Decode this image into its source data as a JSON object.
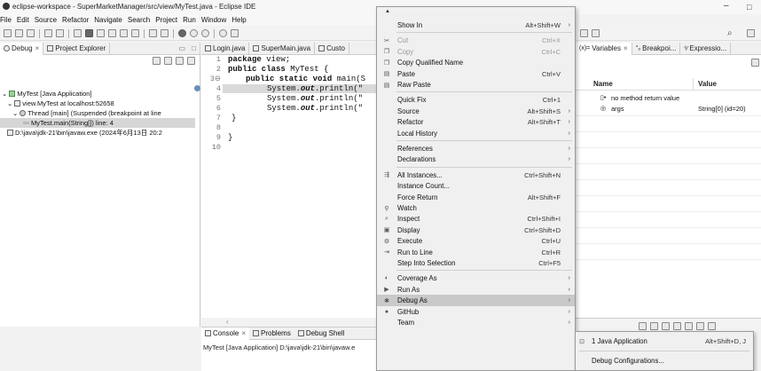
{
  "window": {
    "title": "eclipse-workspace - SuperMarketManager/src/view/MyTest.java - Eclipse IDE",
    "minimize": "–",
    "restore": "□"
  },
  "menubar": [
    "File",
    "Edit",
    "Source",
    "Refactor",
    "Navigate",
    "Search",
    "Project",
    "Run",
    "Window",
    "Help"
  ],
  "left_panel": {
    "tabs": [
      "Debug",
      "Project Explorer"
    ],
    "tab_icons": [
      "bug-icon",
      "folder-icon"
    ],
    "tree": [
      "MyTest [Java Application]",
      "view.MyTest at localhost:52658",
      "Thread [main] (Suspended (breakpoint at line",
      "MyTest.main(String[]) line: 4",
      "D:\\java\\jdk-21\\bin\\javaw.exe (2024年6月13日 20:2"
    ]
  },
  "editor": {
    "tabs": [
      "Login.java",
      "SuperMain.java",
      "Custo"
    ],
    "line_numbers": [
      "1",
      "2",
      "3⊖",
      "4",
      "5",
      "6",
      "7",
      "8",
      "9",
      "10"
    ],
    "lines": {
      "l1_kw": "package",
      "l1_rest": " view;",
      "l2_kw": "public class",
      "l2_rest": " MyTest {",
      "l3_kw": "public static void",
      "l3_rest": " main(S",
      "l4_pre": "System.",
      "l4_it": "out",
      "l4_post": ".println(\"",
      "l5_pre": "System.",
      "l5_it": "out",
      "l5_post": ".println(\"",
      "l6_pre": "System.",
      "l6_it": "out",
      "l6_post": ".println(\"",
      "l7": "}",
      "l9": "}"
    }
  },
  "bottom_panel": {
    "tabs": [
      "Console",
      "Problems",
      "Debug Shell"
    ],
    "console_text": "MyTest [Java Application] D:\\java\\jdk-21\\bin\\javaw.e"
  },
  "right_panel": {
    "tabs": [
      "Variables",
      "Breakpoi...",
      "Expressio..."
    ],
    "columns": [
      "Name",
      "Value"
    ],
    "rows": [
      {
        "name": "no method return value",
        "value": ""
      },
      {
        "name": "args",
        "value": "String[0]  (id=20)"
      }
    ]
  },
  "context_menu": {
    "items": [
      {
        "label": "Show In",
        "shortcut": "Alt+Shift+W",
        "submenu": true,
        "icon": "",
        "disabled": false
      },
      {
        "sep": true
      },
      {
        "label": "Cut",
        "shortcut": "Ctrl+X",
        "icon": "cut-icon",
        "disabled": true
      },
      {
        "label": "Copy",
        "shortcut": "Ctrl+C",
        "icon": "copy-icon",
        "disabled": true
      },
      {
        "label": "Copy Qualified Name",
        "shortcut": "",
        "icon": "copy-icon",
        "disabled": false
      },
      {
        "label": "Paste",
        "shortcut": "Ctrl+V",
        "icon": "paste-icon",
        "disabled": false
      },
      {
        "label": "Raw Paste",
        "shortcut": "",
        "icon": "paste-icon",
        "disabled": false
      },
      {
        "sep": true
      },
      {
        "label": "Quick Fix",
        "shortcut": "Ctrl+1",
        "icon": "",
        "disabled": false
      },
      {
        "label": "Source",
        "shortcut": "Alt+Shift+S",
        "submenu": true,
        "icon": "",
        "disabled": false
      },
      {
        "label": "Refactor",
        "shortcut": "Alt+Shift+T",
        "submenu": true,
        "icon": "",
        "disabled": false
      },
      {
        "label": "Local History",
        "shortcut": "",
        "submenu": true,
        "icon": "",
        "disabled": false
      },
      {
        "sep": true
      },
      {
        "label": "References",
        "shortcut": "",
        "submenu": true,
        "icon": "",
        "disabled": false
      },
      {
        "label": "Declarations",
        "shortcut": "",
        "submenu": true,
        "icon": "",
        "disabled": false
      },
      {
        "sep": true
      },
      {
        "label": "All Instances...",
        "shortcut": "Ctrl+Shift+N",
        "icon": "instances-icon",
        "disabled": false
      },
      {
        "label": "Instance Count...",
        "shortcut": "",
        "icon": "",
        "disabled": false
      },
      {
        "label": "Force Return",
        "shortcut": "Alt+Shift+F",
        "icon": "",
        "disabled": false
      },
      {
        "label": "Watch",
        "shortcut": "",
        "icon": "watch-icon",
        "disabled": false
      },
      {
        "label": "Inspect",
        "shortcut": "Ctrl+Shift+I",
        "icon": "inspect-icon",
        "disabled": false
      },
      {
        "label": "Display",
        "shortcut": "Ctrl+Shift+D",
        "icon": "display-icon",
        "disabled": false
      },
      {
        "label": "Execute",
        "shortcut": "Ctrl+U",
        "icon": "execute-icon",
        "disabled": false
      },
      {
        "label": "Run to Line",
        "shortcut": "Ctrl+R",
        "icon": "run-to-line-icon",
        "disabled": false
      },
      {
        "label": "Step Into Selection",
        "shortcut": "Ctrl+F5",
        "icon": "",
        "disabled": false
      },
      {
        "sep": true
      },
      {
        "label": "Coverage As",
        "shortcut": "",
        "submenu": true,
        "icon": "coverage-icon",
        "disabled": false
      },
      {
        "label": "Run As",
        "shortcut": "",
        "submenu": true,
        "icon": "run-icon",
        "disabled": false
      },
      {
        "label": "Debug As",
        "shortcut": "",
        "submenu": true,
        "icon": "debug-icon",
        "disabled": false,
        "highlight": true
      },
      {
        "label": "GitHub",
        "shortcut": "",
        "submenu": true,
        "icon": "github-icon",
        "disabled": false
      },
      {
        "label": "Team",
        "shortcut": "",
        "submenu": true,
        "icon": "",
        "disabled": false
      }
    ]
  },
  "submenu": {
    "items": [
      {
        "label": "1 Java Application",
        "shortcut": "Alt+Shift+D, J",
        "icon": "java-app-icon"
      },
      {
        "label": "Debug Configurations...",
        "shortcut": "",
        "icon": ""
      }
    ]
  }
}
